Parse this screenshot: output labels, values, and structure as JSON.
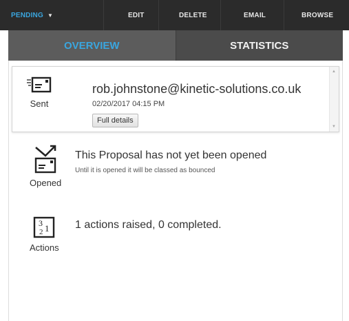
{
  "toolbar": {
    "pending_label": "PENDING",
    "edit_label": "EDIT",
    "delete_label": "DELETE",
    "email_label": "EMAIL",
    "browse_label": "BROWSE"
  },
  "tabs": [
    {
      "label": "OVERVIEW",
      "active": true
    },
    {
      "label": "STATISTICS",
      "active": false
    }
  ],
  "sent": {
    "icon": "envelope-sent-icon",
    "label": "Sent",
    "email": "rob.johnstone@kinetic-solutions.co.uk",
    "datetime": "02/20/2017 04:15 PM",
    "button_label": "Full details"
  },
  "opened": {
    "icon": "envelope-open-icon",
    "label": "Opened",
    "title": "This Proposal has not yet been opened",
    "subtitle": "Until it is opened it will be classed as bounced"
  },
  "actions": {
    "icon": "actions-count-icon",
    "label": "Actions",
    "title": "1 actions raised, 0 completed."
  },
  "colors": {
    "toolbar_bg": "#2b2b2b",
    "tabs_bg": "#4b4b4b",
    "accent": "#3aa6df"
  }
}
